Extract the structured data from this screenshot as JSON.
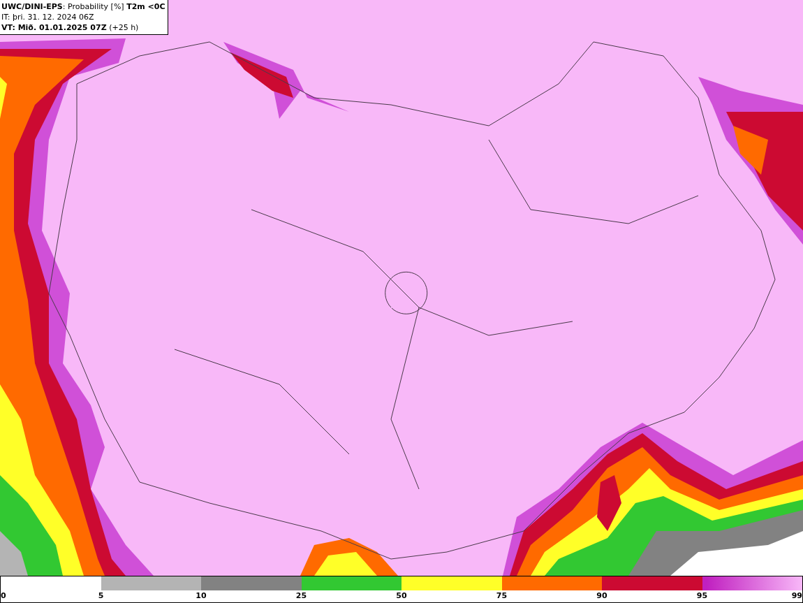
{
  "header": {
    "title": "**UWC/DINI-EPS**: Probability [%] **T2m <0C**",
    "issue_time": "IT: þri. 31. 12. 2024 06Z",
    "valid_time": "**VT: Mið. 01.01.2025 07Z** (+25 h)"
  },
  "legend": {
    "segments": [
      {
        "kind": "empty"
      },
      {
        "color": "#b4b4b4",
        "kind": "solid"
      },
      {
        "color": "#828282",
        "kind": "solid"
      },
      {
        "color": "#32c832",
        "kind": "solid"
      },
      {
        "color": "#ffff28",
        "kind": "solid"
      },
      {
        "color": "#ff6a00",
        "kind": "solid"
      },
      {
        "color": "#cc0a32",
        "kind": "solid"
      },
      {
        "color": "#c020c0",
        "kind": "gradient"
      }
    ],
    "labels": [
      "0",
      "5",
      "10",
      "25",
      "50",
      "75",
      "90",
      "95",
      "99"
    ]
  }
}
